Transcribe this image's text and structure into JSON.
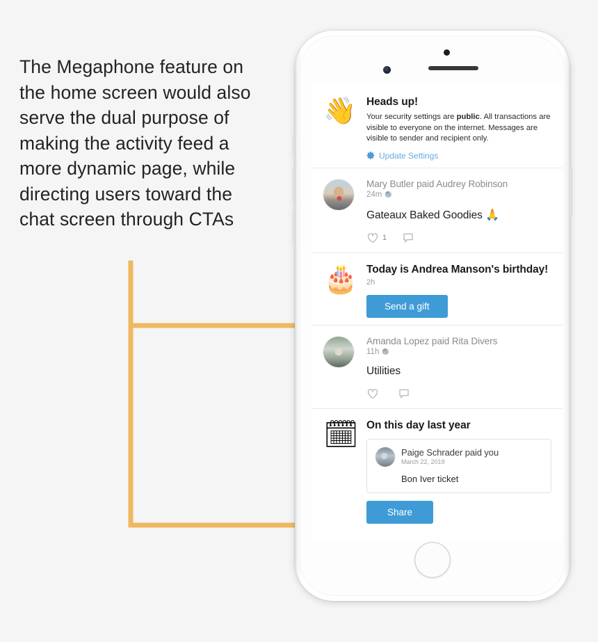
{
  "annotation": {
    "text": "The Megaphone feature on the home screen would also serve the dual purpose of making the activity feed a more dynamic page, while directing users toward the chat screen through CTAs",
    "accent_color": "#efb961"
  },
  "theme": {
    "background": "#f5f5f5",
    "primary_blue": "#3f9bd6",
    "link_blue": "#69a9dd",
    "card_white": "#ffffff",
    "divider": "#e9e9e9"
  },
  "feed": {
    "items": [
      {
        "type": "heads-up-card",
        "icon": "waving-hand-emoji",
        "icon_glyph": "👋",
        "title": "Heads up!",
        "description_before": "Your security settings are ",
        "description_bold": "public",
        "description_after": ". All transactions are visible to everyone on the internet. Messages are visible to sender and recipient only.",
        "link_label": "Update Settings",
        "link_icon": "gear-icon"
      },
      {
        "type": "payment",
        "avatar": "mary-butler-avatar",
        "payline": "Mary Butler paid Audrey Robinson",
        "time": "24m",
        "privacy_icon": "globe-icon",
        "memo": "Gateaux Baked Goodies",
        "memo_emoji": "🙏",
        "like_count": "1",
        "like_icon": "heart-icon",
        "comment_icon": "comment-icon"
      },
      {
        "type": "birthday-card",
        "icon": "birthday-cake-emoji",
        "icon_glyph": "🎂",
        "title": "Today is Andrea Manson's birthday!",
        "time": "2h",
        "button_label": "Send a gift"
      },
      {
        "type": "payment",
        "avatar": "amanda-lopez-avatar",
        "payline": "Amanda Lopez paid Rita Divers",
        "time": "11h",
        "privacy_icon": "globe-icon",
        "memo": "Utilities",
        "memo_emoji": "",
        "like_count": "",
        "like_icon": "heart-icon",
        "comment_icon": "comment-icon"
      },
      {
        "type": "memory-card",
        "icon": "calendar-emoji",
        "icon_glyph": "🗓",
        "title": "On this day last year",
        "memory": {
          "avatar": "paige-schrader-avatar",
          "payline": "Paige Schrader paid you",
          "date": "March 22, 2019",
          "memo": "Bon Iver ticket"
        },
        "button_label": "Share"
      }
    ]
  }
}
